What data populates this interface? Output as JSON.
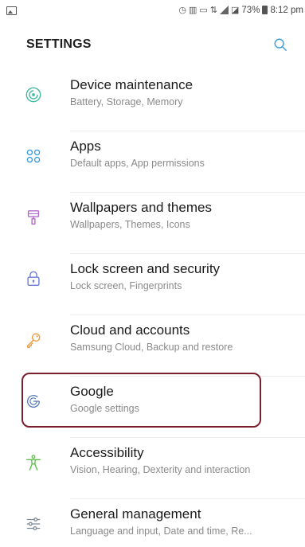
{
  "status_bar": {
    "notification_icon": "image-icon",
    "battery": "73%",
    "time": "8:12 pm",
    "icons": [
      "alarm-icon",
      "volte-icon",
      "cast-icon",
      "lte-icon",
      "signal-icon",
      "battery-icon"
    ]
  },
  "header": {
    "title": "SETTINGS",
    "search_icon": "search-icon"
  },
  "items": [
    {
      "title": "Device maintenance",
      "subtitle": "Battery, Storage, Memory",
      "icon": "device-maintenance-icon",
      "icon_color": "#3fb8a0"
    },
    {
      "title": "Apps",
      "subtitle": "Default apps, App permissions",
      "icon": "apps-icon",
      "icon_color": "#3a9fe0"
    },
    {
      "title": "Wallpapers and themes",
      "subtitle": "Wallpapers, Themes, Icons",
      "icon": "paintbrush-icon",
      "icon_color": "#b06ac9"
    },
    {
      "title": "Lock screen and security",
      "subtitle": "Lock screen, Fingerprints",
      "icon": "lock-icon",
      "icon_color": "#6b7bd6"
    },
    {
      "title": "Cloud and accounts",
      "subtitle": "Samsung Cloud, Backup and restore",
      "icon": "key-icon",
      "icon_color": "#e99a3c"
    },
    {
      "title": "Google",
      "subtitle": "Google settings",
      "icon": "google-icon",
      "icon_color": "#5b7fb8"
    },
    {
      "title": "Accessibility",
      "subtitle": "Vision, Hearing, Dexterity and interaction",
      "icon": "accessibility-icon",
      "icon_color": "#5cbf4a"
    },
    {
      "title": "General management",
      "subtitle": "Language and input, Date and time, Re...",
      "icon": "sliders-icon",
      "icon_color": "#7d8a96"
    }
  ],
  "highlight_color": "#7a1f2e"
}
